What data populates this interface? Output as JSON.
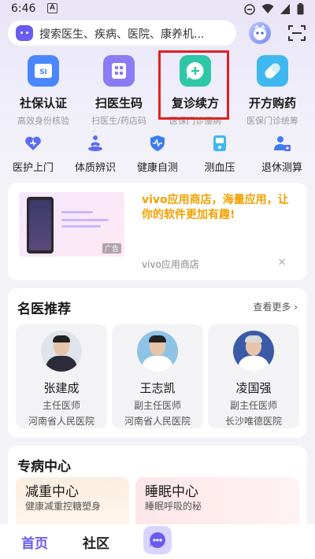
{
  "status_bar": {
    "time": "6:46",
    "notification_letter": "A"
  },
  "search": {
    "placeholder": "搜索医生、疾病、医院、康养机..."
  },
  "services": [
    {
      "title": "社保认证",
      "subtitle": "高效身份核验",
      "icon": "id-card-icon",
      "color": "#4a86ff",
      "glyph": "SI"
    },
    {
      "title": "扫医生码",
      "subtitle": "扫医生/药店码",
      "icon": "qr-scan-icon",
      "color": "#8a7cf5",
      "glyph": ""
    },
    {
      "title": "复诊续方",
      "subtitle": "医保门诊慢病",
      "icon": "chat-plus-icon",
      "color": "#2ec7a8",
      "glyph": "+"
    },
    {
      "title": "开方购药",
      "subtitle": "医保门诊统筹",
      "icon": "pill-icon",
      "color": "#3fb8f0",
      "glyph": ""
    }
  ],
  "features": [
    {
      "label": "医护上门",
      "icon": "nurse-heart-icon"
    },
    {
      "label": "体质辨识",
      "icon": "meditation-icon"
    },
    {
      "label": "健康自测",
      "icon": "shield-pulse-icon"
    },
    {
      "label": "测血压",
      "icon": "blood-pressure-icon"
    },
    {
      "label": "退休测算",
      "icon": "retirement-calc-icon"
    }
  ],
  "ad": {
    "title": "vivo应用商店，海量应用，让你的软件更加有趣!",
    "source": "vivo应用商店",
    "tag": "广告",
    "close": "×"
  },
  "doctors_section": {
    "title": "名医推荐",
    "more": "查看更多 ›",
    "doctors": [
      {
        "name": "张建成",
        "title": "主任医师",
        "hospital": "河南省人民医院",
        "coat_color": "#2b2b3a",
        "bg": "#dfe3ea"
      },
      {
        "name": "王志凯",
        "title": "副主任医师",
        "hospital": "河南省人民医院",
        "coat_color": "#ffffff",
        "bg": "#8fc3e6"
      },
      {
        "name": "凌国强",
        "title": "副主任医师",
        "hospital": "长沙唯德医院",
        "coat_color": "#ffffff",
        "bg": "#3a5aa8"
      }
    ]
  },
  "specialty_section": {
    "title": "专病中心",
    "centers": [
      {
        "name": "减重中心",
        "desc": "健康减重控糖塑身",
        "bg": "#fbeee0"
      },
      {
        "name": "睡眠中心",
        "desc": "睡眠呼吸的秘",
        "bg": "#fde6e8"
      }
    ]
  },
  "bottom_nav": {
    "home": "首页",
    "community": "社区"
  }
}
